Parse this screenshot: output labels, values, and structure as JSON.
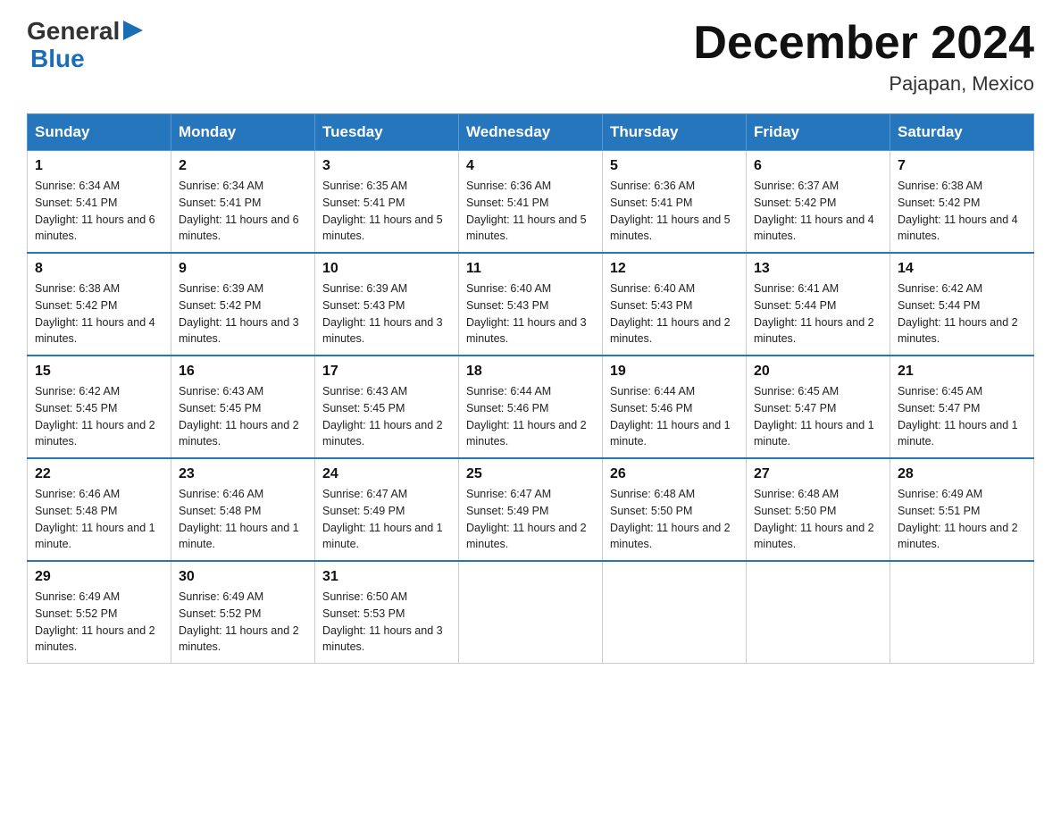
{
  "header": {
    "logo_general": "General",
    "logo_blue": "Blue",
    "month_title": "December 2024",
    "location": "Pajapan, Mexico"
  },
  "days_of_week": [
    "Sunday",
    "Monday",
    "Tuesday",
    "Wednesday",
    "Thursday",
    "Friday",
    "Saturday"
  ],
  "weeks": [
    [
      {
        "day": 1,
        "sunrise": "6:34 AM",
        "sunset": "5:41 PM",
        "daylight": "11 hours and 6 minutes."
      },
      {
        "day": 2,
        "sunrise": "6:34 AM",
        "sunset": "5:41 PM",
        "daylight": "11 hours and 6 minutes."
      },
      {
        "day": 3,
        "sunrise": "6:35 AM",
        "sunset": "5:41 PM",
        "daylight": "11 hours and 5 minutes."
      },
      {
        "day": 4,
        "sunrise": "6:36 AM",
        "sunset": "5:41 PM",
        "daylight": "11 hours and 5 minutes."
      },
      {
        "day": 5,
        "sunrise": "6:36 AM",
        "sunset": "5:41 PM",
        "daylight": "11 hours and 5 minutes."
      },
      {
        "day": 6,
        "sunrise": "6:37 AM",
        "sunset": "5:42 PM",
        "daylight": "11 hours and 4 minutes."
      },
      {
        "day": 7,
        "sunrise": "6:38 AM",
        "sunset": "5:42 PM",
        "daylight": "11 hours and 4 minutes."
      }
    ],
    [
      {
        "day": 8,
        "sunrise": "6:38 AM",
        "sunset": "5:42 PM",
        "daylight": "11 hours and 4 minutes."
      },
      {
        "day": 9,
        "sunrise": "6:39 AM",
        "sunset": "5:42 PM",
        "daylight": "11 hours and 3 minutes."
      },
      {
        "day": 10,
        "sunrise": "6:39 AM",
        "sunset": "5:43 PM",
        "daylight": "11 hours and 3 minutes."
      },
      {
        "day": 11,
        "sunrise": "6:40 AM",
        "sunset": "5:43 PM",
        "daylight": "11 hours and 3 minutes."
      },
      {
        "day": 12,
        "sunrise": "6:40 AM",
        "sunset": "5:43 PM",
        "daylight": "11 hours and 2 minutes."
      },
      {
        "day": 13,
        "sunrise": "6:41 AM",
        "sunset": "5:44 PM",
        "daylight": "11 hours and 2 minutes."
      },
      {
        "day": 14,
        "sunrise": "6:42 AM",
        "sunset": "5:44 PM",
        "daylight": "11 hours and 2 minutes."
      }
    ],
    [
      {
        "day": 15,
        "sunrise": "6:42 AM",
        "sunset": "5:45 PM",
        "daylight": "11 hours and 2 minutes."
      },
      {
        "day": 16,
        "sunrise": "6:43 AM",
        "sunset": "5:45 PM",
        "daylight": "11 hours and 2 minutes."
      },
      {
        "day": 17,
        "sunrise": "6:43 AM",
        "sunset": "5:45 PM",
        "daylight": "11 hours and 2 minutes."
      },
      {
        "day": 18,
        "sunrise": "6:44 AM",
        "sunset": "5:46 PM",
        "daylight": "11 hours and 2 minutes."
      },
      {
        "day": 19,
        "sunrise": "6:44 AM",
        "sunset": "5:46 PM",
        "daylight": "11 hours and 1 minute."
      },
      {
        "day": 20,
        "sunrise": "6:45 AM",
        "sunset": "5:47 PM",
        "daylight": "11 hours and 1 minute."
      },
      {
        "day": 21,
        "sunrise": "6:45 AM",
        "sunset": "5:47 PM",
        "daylight": "11 hours and 1 minute."
      }
    ],
    [
      {
        "day": 22,
        "sunrise": "6:46 AM",
        "sunset": "5:48 PM",
        "daylight": "11 hours and 1 minute."
      },
      {
        "day": 23,
        "sunrise": "6:46 AM",
        "sunset": "5:48 PM",
        "daylight": "11 hours and 1 minute."
      },
      {
        "day": 24,
        "sunrise": "6:47 AM",
        "sunset": "5:49 PM",
        "daylight": "11 hours and 1 minute."
      },
      {
        "day": 25,
        "sunrise": "6:47 AM",
        "sunset": "5:49 PM",
        "daylight": "11 hours and 2 minutes."
      },
      {
        "day": 26,
        "sunrise": "6:48 AM",
        "sunset": "5:50 PM",
        "daylight": "11 hours and 2 minutes."
      },
      {
        "day": 27,
        "sunrise": "6:48 AM",
        "sunset": "5:50 PM",
        "daylight": "11 hours and 2 minutes."
      },
      {
        "day": 28,
        "sunrise": "6:49 AM",
        "sunset": "5:51 PM",
        "daylight": "11 hours and 2 minutes."
      }
    ],
    [
      {
        "day": 29,
        "sunrise": "6:49 AM",
        "sunset": "5:52 PM",
        "daylight": "11 hours and 2 minutes."
      },
      {
        "day": 30,
        "sunrise": "6:49 AM",
        "sunset": "5:52 PM",
        "daylight": "11 hours and 2 minutes."
      },
      {
        "day": 31,
        "sunrise": "6:50 AM",
        "sunset": "5:53 PM",
        "daylight": "11 hours and 3 minutes."
      },
      null,
      null,
      null,
      null
    ]
  ]
}
